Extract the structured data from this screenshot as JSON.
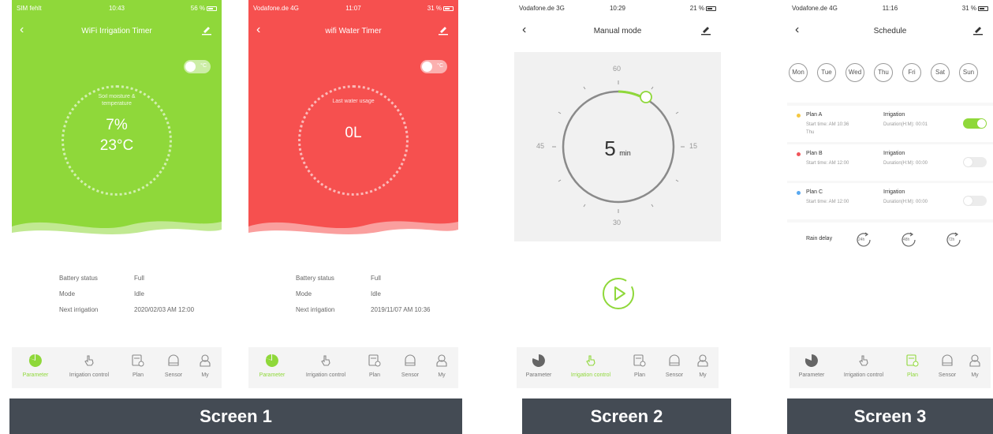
{
  "screen1a": {
    "status": {
      "carrier": "SIM fehlt",
      "time": "10:43",
      "battery": "56 %"
    },
    "title": "WiFi Irrigation Timer",
    "toggle_unit": "°C",
    "dial_label_1": "Soil moisture &",
    "dial_label_2": "temperature",
    "moisture": "7%",
    "temperature": "23°C",
    "info": [
      {
        "key": "Battery status",
        "value": "Full"
      },
      {
        "key": "Mode",
        "value": "Idle"
      },
      {
        "key": "Next irrigation",
        "value": "2020/02/03 AM 12:00"
      }
    ],
    "tabs": [
      "Parameter",
      "Irrigation control",
      "Plan",
      "Sensor",
      "My"
    ]
  },
  "screen1b": {
    "status": {
      "carrier": "Vodafone.de 4G",
      "time": "11:07",
      "battery": "31 %"
    },
    "title": "wifi Water Timer",
    "toggle_unit": "°C",
    "dial_label": "Last water usage",
    "usage": "0L",
    "info": [
      {
        "key": "Battery status",
        "value": "Full"
      },
      {
        "key": "Mode",
        "value": "Idle"
      },
      {
        "key": "Next irrigation",
        "value": "2019/11/07 AM 10:36"
      }
    ],
    "tabs": [
      "Parameter",
      "Irrigation control",
      "Plan",
      "Sensor",
      "My"
    ]
  },
  "screen2": {
    "status": {
      "carrier": "Vodafone.de 3G",
      "time": "10:29",
      "battery": "21 %"
    },
    "title": "Manual mode",
    "ticks": {
      "top": "60",
      "right": "15",
      "bottom": "30",
      "left": "45"
    },
    "minutes": "5",
    "unit": "min",
    "tabs": [
      "Parameter",
      "Irrigation control",
      "Plan",
      "Sensor",
      "My"
    ]
  },
  "screen3": {
    "status": {
      "carrier": "Vodafone.de 4G",
      "time": "11:16",
      "battery": "31 %"
    },
    "title": "Schedule",
    "days": [
      "Mon",
      "Tue",
      "Wed",
      "Thu",
      "Fri",
      "Sat",
      "Sun"
    ],
    "plans": [
      {
        "name": "Plan A",
        "mode": "Irrigation",
        "start": "Start time: AM 10:36",
        "duration": "Duration(H:M): 00:01",
        "day": "Thu",
        "enabled": true,
        "color": "#f5c842"
      },
      {
        "name": "Plan B",
        "mode": "Irrigation",
        "start": "Start time: AM 12:00",
        "duration": "Duration(H:M): 00:00",
        "day": "",
        "enabled": false,
        "color": "#f0555a"
      },
      {
        "name": "Plan C",
        "mode": "Irrigation",
        "start": "Start time: AM 12:00",
        "duration": "Duration(H:M): 00:00",
        "day": "",
        "enabled": false,
        "color": "#58a8f0"
      }
    ],
    "rain_delay": "Rain delay",
    "rain_options": [
      "24h",
      "48h",
      "72h"
    ],
    "tabs": [
      "Parameter",
      "Irrigation control",
      "Plan",
      "Sensor",
      "My"
    ]
  },
  "captions": [
    "Screen 1",
    "Screen 2",
    "Screen 3"
  ],
  "colors": {
    "green": "#8fd83a",
    "red": "#f6504f",
    "caption_bg": "#444b54"
  }
}
